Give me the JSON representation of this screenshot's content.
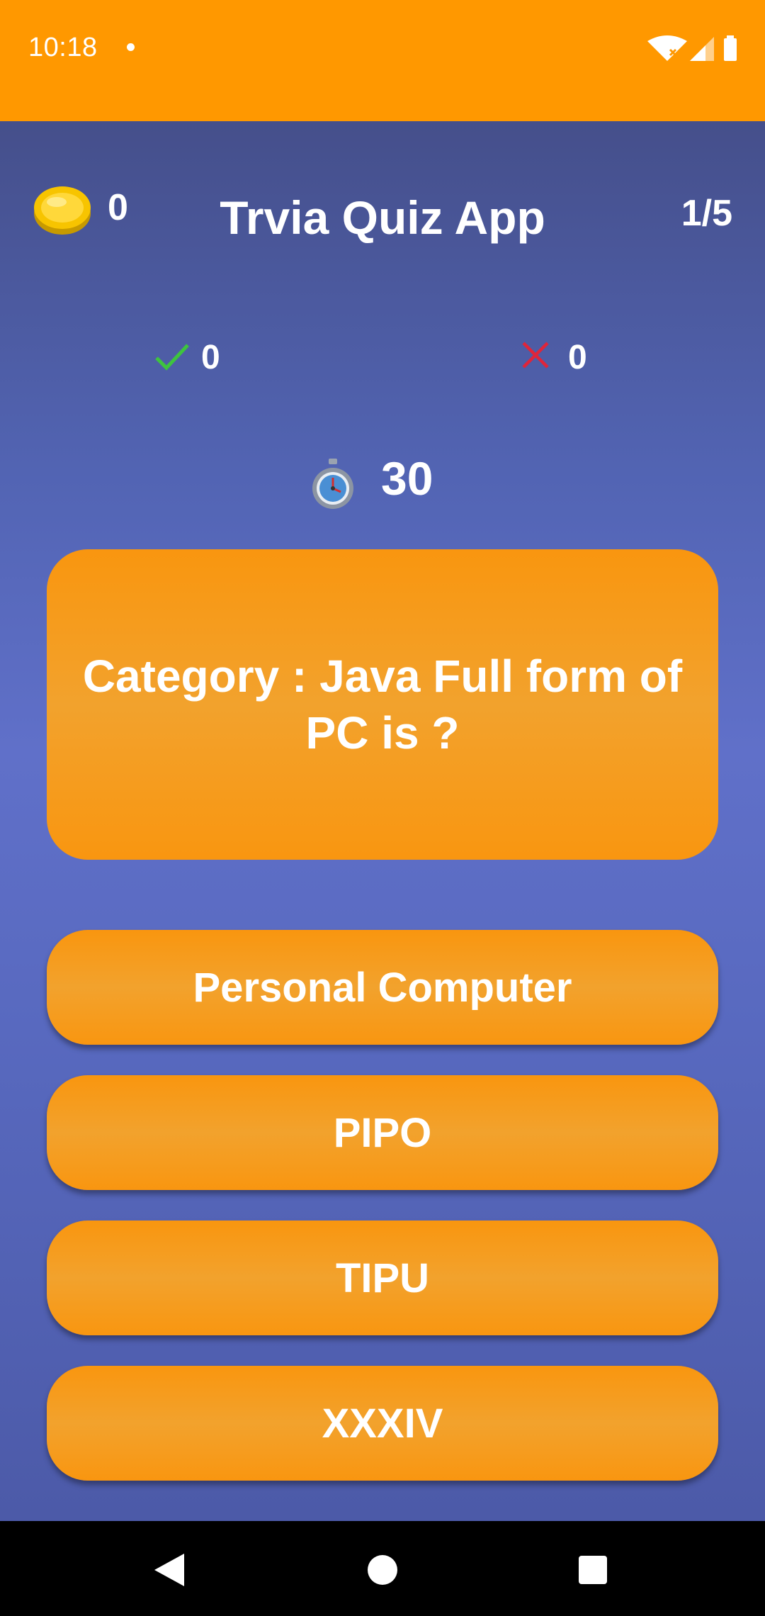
{
  "status_bar": {
    "time": "10:18",
    "background": "#ff9800"
  },
  "header": {
    "coins": "0",
    "title": "Trvia Quiz App",
    "progress": "1/5"
  },
  "score": {
    "correct": "0",
    "wrong": "0"
  },
  "timer": {
    "seconds": "30"
  },
  "question": {
    "text": "Category : Java Full form of PC is ?"
  },
  "answers": [
    {
      "label": "Personal Computer"
    },
    {
      "label": "PIPO"
    },
    {
      "label": "TIPU"
    },
    {
      "label": "XXXIV"
    }
  ],
  "icons": {
    "coin": "coin-icon",
    "correct": "checkmark-icon",
    "wrong": "cross-icon",
    "timer": "stopwatch-icon"
  },
  "colors": {
    "accent_orange": "#f9960f",
    "correct_green": "#4caf50",
    "wrong_red": "#d32f2f"
  }
}
